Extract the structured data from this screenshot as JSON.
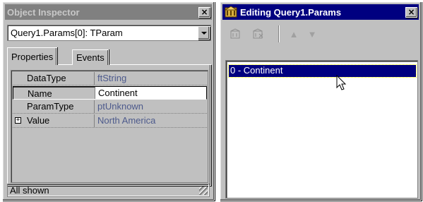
{
  "object_inspector": {
    "title": "Object Inspector",
    "close_glyph": "×",
    "component_selector": "Query1.Params[0]: TParam",
    "tabs": [
      {
        "label": "Properties",
        "active": true
      },
      {
        "label": "Events",
        "active": false
      }
    ],
    "properties": [
      {
        "name": "DataType",
        "value": "ftString",
        "selected": false,
        "expandable": false
      },
      {
        "name": "Name",
        "value": "Continent",
        "selected": true,
        "expandable": false
      },
      {
        "name": "ParamType",
        "value": "ptUnknown",
        "selected": false,
        "expandable": false
      },
      {
        "name": "Value",
        "value": "North America",
        "selected": false,
        "expandable": true
      }
    ],
    "expander_glyph": "+",
    "status": "All shown"
  },
  "params_editor": {
    "title": "Editing Query1.Params",
    "close_glyph": "×",
    "toolbar_icons": [
      "add-icon",
      "delete-icon",
      "move-up-icon",
      "move-down-icon"
    ],
    "toolbar_glyphs": {
      "up": "▲",
      "down": "▼"
    },
    "items": [
      "0 - Continent"
    ]
  },
  "colors": {
    "active_title": "#000080",
    "inactive_title": "#808080",
    "value_text": "#4d5a8c",
    "face": "#c0c0c0"
  }
}
